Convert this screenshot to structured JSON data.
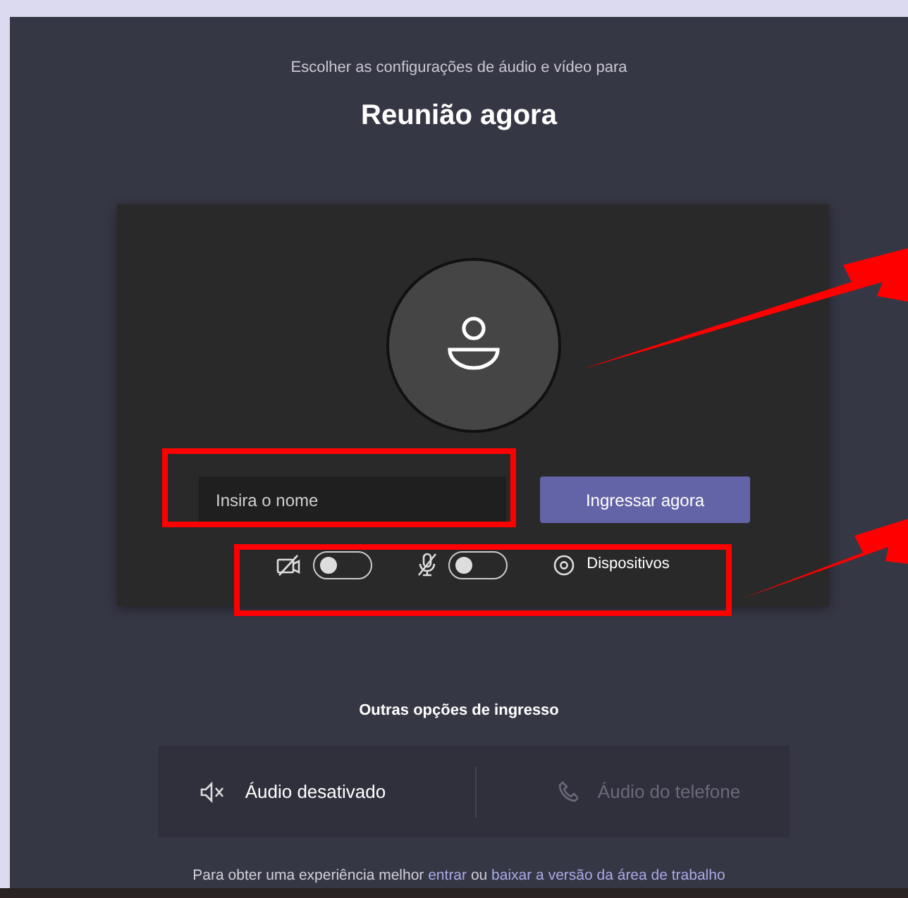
{
  "subtitle": "Escolher as configurações de áudio e vídeo para",
  "title": "Reunião agora",
  "name_field": {
    "placeholder": "Insira o nome"
  },
  "join_button": "Ingressar agora",
  "toggles": [
    {
      "kind": "camera",
      "on": false
    },
    {
      "kind": "mic",
      "on": false
    }
  ],
  "devices_label": "Dispositivos",
  "other_options": {
    "heading": "Outras opções de ingresso",
    "items": [
      {
        "kind": "speaker",
        "label": "Áudio desativado",
        "disabled": false
      },
      {
        "kind": "phone",
        "label": "Áudio do telefone",
        "disabled": true
      }
    ]
  },
  "footer": {
    "text": "Para obter uma experiência melhor",
    "link_1": "entrar",
    "joiner": "ou",
    "link_2": "baixar a versão da área de trabalho"
  }
}
